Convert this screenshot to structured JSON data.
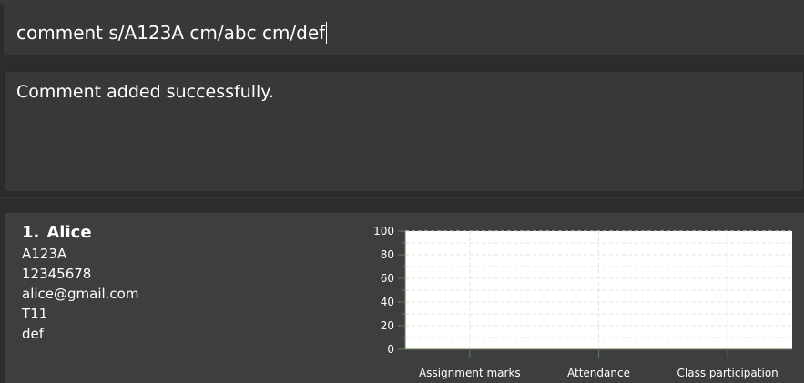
{
  "command_box": {
    "value": "comment s/A123A cm/abc cm/def"
  },
  "result_display": {
    "message": "Comment added successfully."
  },
  "person_list": [
    {
      "index": "1.",
      "name": "Alice",
      "student_id": "A123A",
      "phone": "12345678",
      "email": "alice@gmail.com",
      "tutorial": "T11",
      "comment": "def",
      "chart_data": {
        "type": "bar",
        "categories": [
          "Assignment marks",
          "Attendance",
          "Class participation"
        ],
        "values": [
          0,
          0,
          0
        ],
        "ylim": [
          0,
          100
        ],
        "yticks": [
          0,
          20,
          40,
          60,
          80,
          100
        ],
        "grid": true,
        "colors": {
          "plot_bg": "#ffffff",
          "grid": "#e3e3e3",
          "axis": "#6b7a5a"
        }
      }
    }
  ]
}
